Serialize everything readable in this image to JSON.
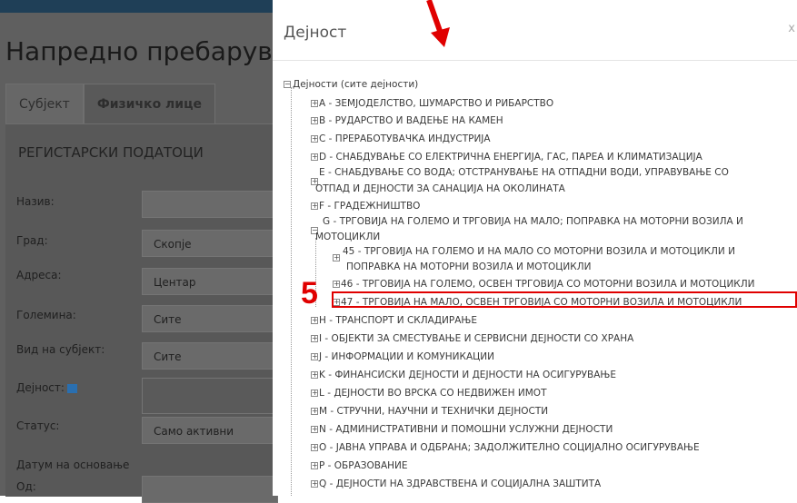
{
  "background_page": {
    "title": "Напредно пребарув",
    "tabs": [
      "Субјект",
      "Физичко лице"
    ],
    "section_title": "РЕГИСТАРСКИ ПОДАТОЦИ",
    "fields": [
      {
        "label": "Назив:",
        "value": ""
      },
      {
        "label": "Град:",
        "value": "Скопје"
      },
      {
        "label": "Адреса:",
        "value": "Центар"
      },
      {
        "label": "Големина:",
        "value": "Сите"
      },
      {
        "label": "Вид на субјект:",
        "value": "Сите"
      },
      {
        "label": "Дејност:",
        "value": ""
      },
      {
        "label": "Статус:",
        "value": "Само активни"
      },
      {
        "label": "Датум на основање",
        "value": ""
      },
      {
        "label": "Од:",
        "value": ""
      }
    ]
  },
  "modal": {
    "title": "Дејност",
    "close": "x",
    "root": {
      "toggle": "⊟",
      "label": "Дејности (сите дејности)"
    },
    "items": [
      {
        "label": "A - ЗЕМЈОДЕЛСТВО, ШУМАРСТВО И РИБАРСТВО"
      },
      {
        "label": "B - РУДАРСТВО И ВАДЕЊЕ НА КАМЕН"
      },
      {
        "label": "C - ПРЕРАБОТУВАЧКА ИНДУСТРИЈА"
      },
      {
        "label": "D - СНАБДУВАЊЕ СО ЕЛЕКТРИЧНА ЕНЕРГИЈА, ГАС, ПАРЕА И КЛИМАТИЗАЦИЈА"
      },
      {
        "label": "E - СНАБДУВАЊЕ СО ВОДА; ОТСТРАНУВАЊЕ НА ОТПАДНИ ВОДИ, УПРАВУВАЊЕ СО",
        "label2": "ОТПАД И ДЕЈНОСТИ ЗА САНАЦИЈА НА ОКОЛИНАТА"
      },
      {
        "label": "F - ГРАДЕЖНИШТВО"
      },
      {
        "label": "G - ТРГОВИЈА НА ГОЛЕМО И ТРГОВИЈА НА МАЛО; ПОПРАВКА НА МОТОРНИ ВОЗИЛА И",
        "label2": "МОТОЦИКЛИ"
      }
    ],
    "children_g": [
      {
        "label": "45 - ТРГОВИЈА НА ГОЛЕМО И НА МАЛО СО МОТОРНИ ВОЗИЛА И МОТОЦИКЛИ И",
        "label2": "ПОПРАВКА НА МОТОРНИ ВОЗИЛА И МОТОЦИКЛИ"
      },
      {
        "label": "46 - ТРГОВИЈА НА ГОЛЕМО, ОСВЕН ТРГОВИЈА СО МОТОРНИ ВОЗИЛА И МОТОЦИКЛИ"
      },
      {
        "label": "47 - ТРГОВИЈА НА МАЛО, ОСВЕН ТРГОВИЈА СО МОТОРНИ ВОЗИЛА И МОТОЦИКЛИ"
      }
    ],
    "items_after": [
      {
        "label": "H - ТРАНСПОРТ И СКЛАДИРАЊЕ"
      },
      {
        "label": "I - ОБЈЕКТИ ЗА СМЕСТУВАЊЕ И СЕРВИСНИ ДЕЈНОСТИ СО ХРАНА"
      },
      {
        "label": "J - ИНФОРМАЦИИ И КОМУНИКАЦИИ"
      },
      {
        "label": "K - ФИНАНСИСКИ ДЕЈНОСТИ И ДЕЈНОСТИ НА ОСИГУРУВАЊЕ"
      },
      {
        "label": "L - ДЕЈНОСТИ ВО ВРСКА СО НЕДВИЖЕН ИМОТ"
      },
      {
        "label": "M - СТРУЧНИ, НАУЧНИ И ТЕХНИЧКИ ДЕЈНОСТИ"
      },
      {
        "label": "N - АДМИНИСТРАТИВНИ И ПОМОШНИ УСЛУЖНИ ДЕЈНОСТИ"
      },
      {
        "label": "O - ЈАВНА УПРАВА И ОДБРАНА; ЗАДОЛЖИТЕЛНО СОЦИЈАЛНО ОСИГУРУВАЊЕ"
      },
      {
        "label": "P - ОБРАЗОВАНИЕ"
      },
      {
        "label": "Q - ДЕЈНОСТИ НА ЗДРАВСТВЕНА И СОЦИЈАЛНА ЗАШТИТА"
      }
    ]
  },
  "annotation": {
    "step_number": "5",
    "color": "#e00000"
  }
}
